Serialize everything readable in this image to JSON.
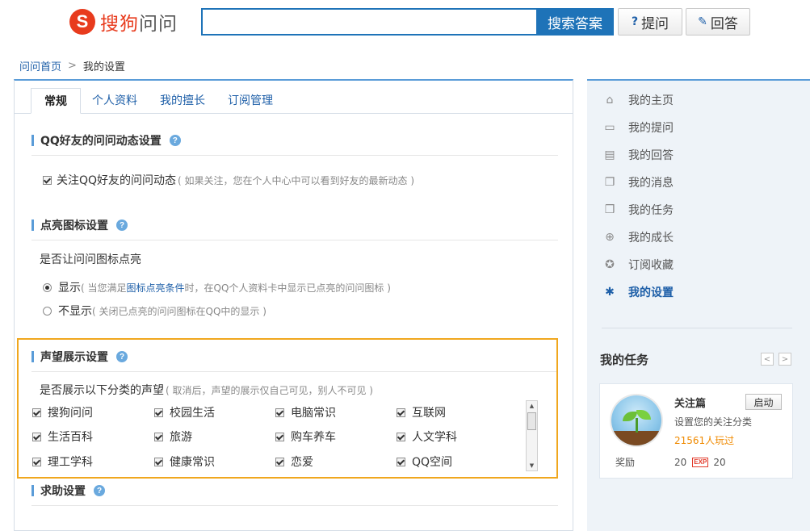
{
  "header": {
    "logo_mark": "S",
    "logo_text_a": "搜狗",
    "logo_text_b": "问问",
    "search_placeholder": "",
    "search_button": "搜索答案",
    "ask_button": "提问",
    "answer_button": "回答"
  },
  "breadcrumb": {
    "home": "问问首页",
    "separator": ">",
    "current": "我的设置"
  },
  "tabs": [
    {
      "label": "常规",
      "active": true
    },
    {
      "label": "个人资料"
    },
    {
      "label": "我的擅长"
    },
    {
      "label": "订阅管理"
    }
  ],
  "sections": {
    "qq": {
      "title": "QQ好友的问问动态设置",
      "checkbox_label": "关注QQ好友的问问动态",
      "note": "( 如果关注，您在个人中心中可以看到好友的最新动态 )",
      "checked": true
    },
    "icon": {
      "title": "点亮图标设置",
      "question": "是否让问问图标点亮",
      "show_label": "显示",
      "show_note_a": "( 当您满足",
      "show_note_link": "图标点亮条件",
      "show_note_b": "时，在QQ个人资料卡中显示已点亮的问问图标 )",
      "hide_label": "不显示",
      "hide_note": "( 关闭已点亮的问问图标在QQ中的显示 )",
      "selected": "show"
    },
    "reputation": {
      "title": "声望展示设置",
      "question": "是否展示以下分类的声望",
      "note": "( 取消后，声望的展示仅自己可见，别人不可见 )",
      "categories": [
        "搜狗问问",
        "校园生活",
        "电脑常识",
        "互联网",
        "生活百科",
        "旅游",
        "购车养车",
        "人文学科",
        "理工学科",
        "健康常识",
        "恋爱",
        "QQ空间"
      ]
    },
    "help": {
      "title": "求助设置"
    }
  },
  "sidebar": {
    "menu": [
      {
        "label": "我的主页",
        "icon": "home-icon",
        "glyph": "⌂"
      },
      {
        "label": "我的提问",
        "icon": "question-bubble-icon",
        "glyph": "▭"
      },
      {
        "label": "我的回答",
        "icon": "answer-bubble-icon",
        "glyph": "▤"
      },
      {
        "label": "我的消息",
        "icon": "message-icon",
        "glyph": "❐"
      },
      {
        "label": "我的任务",
        "icon": "task-icon",
        "glyph": "❒"
      },
      {
        "label": "我的成长",
        "icon": "growth-icon",
        "glyph": "⊕"
      },
      {
        "label": "订阅收藏",
        "icon": "star-icon",
        "glyph": "✪"
      },
      {
        "label": "我的设置",
        "icon": "gear-icon",
        "glyph": "✱",
        "active": true
      }
    ],
    "tasks": {
      "title": "我的任务",
      "prev": "<",
      "next": ">",
      "name": "关注篇",
      "start_button": "启动",
      "desc": "设置您的关注分类",
      "count": "21561人玩过",
      "reward_label": "奖励",
      "reward_points": "20",
      "exp_badge": "EXP",
      "reward_exp": "20"
    }
  },
  "colors": {
    "accent": "#1e73b8",
    "highlight_border": "#f0a71e",
    "brand": "#e83b1d"
  }
}
